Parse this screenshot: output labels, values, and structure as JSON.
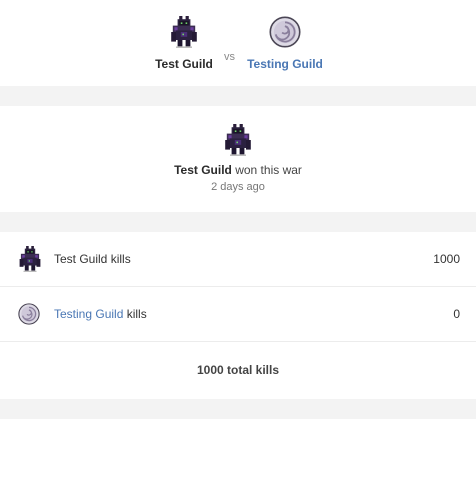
{
  "header": {
    "guild_a": {
      "name": "Test Guild",
      "icon": "dark-knight-icon"
    },
    "vs_label": "vs",
    "guild_b": {
      "name": "Testing Guild",
      "icon": "swirl-orb-icon"
    }
  },
  "result": {
    "winner_name": "Test Guild",
    "won_text": " won this war",
    "time": "2 days ago"
  },
  "kills": [
    {
      "guild": "Test Guild",
      "suffix": " kills",
      "value": "1000",
      "link": false
    },
    {
      "guild": "Testing Guild",
      "suffix": " kills",
      "value": "0",
      "link": true
    }
  ],
  "total_text": "1000 total kills",
  "colors": {
    "link": "#4a77b4",
    "divider_band": "#f3f3f3"
  }
}
